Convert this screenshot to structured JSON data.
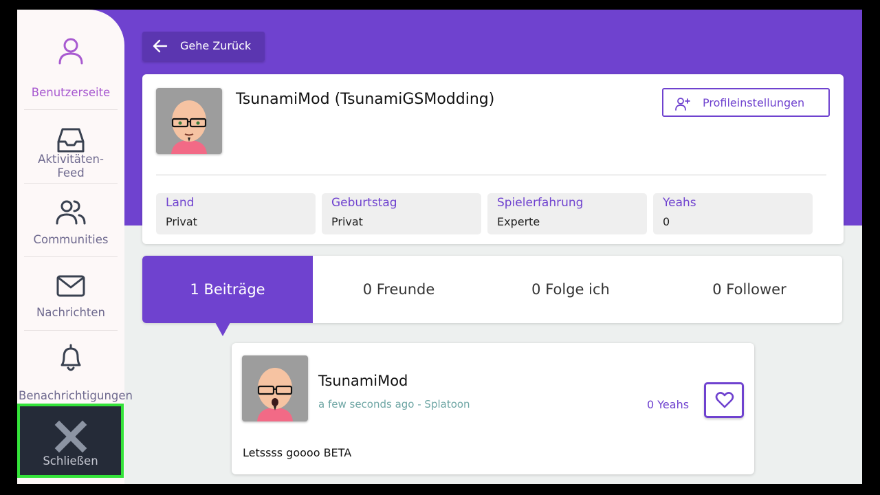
{
  "sidebar": {
    "items": [
      {
        "label": "Benutzerseite",
        "icon": "user-icon"
      },
      {
        "label": "Aktivitäten-",
        "label2": "Feed",
        "icon": "inbox-icon"
      },
      {
        "label": "Communities",
        "icon": "users-icon"
      },
      {
        "label": "Nachrichten",
        "icon": "mail-icon"
      },
      {
        "label": "Benachrichtigungen",
        "icon": "bell-icon"
      }
    ],
    "close_label": "Schließen"
  },
  "back_button": {
    "label": "Gehe Zurück",
    "icon": "arrow-left-icon"
  },
  "profile": {
    "name": "TsunamiMod (TsunamiGSModding)",
    "settings_label": "Profileinstellungen",
    "stats": [
      {
        "key": "Land",
        "value": "Privat"
      },
      {
        "key": "Geburtstag",
        "value": "Privat"
      },
      {
        "key": "Spielerfahrung",
        "value": "Experte"
      },
      {
        "key": "Yeahs",
        "value": "0"
      }
    ]
  },
  "tabs": [
    {
      "label": "1 Beiträge",
      "active": true
    },
    {
      "label": "0 Freunde"
    },
    {
      "label": "0 Folge ich"
    },
    {
      "label": "0 Follower"
    }
  ],
  "post": {
    "author": "TsunamiMod",
    "meta": "a few seconds ago - Splatoon",
    "yeahs": "0 Yeahs",
    "body": "Letssss goooo BETA"
  },
  "colors": {
    "accent": "#6f42cf",
    "sidebar_bg": "#fdf8f8",
    "focus": "#34e33a"
  }
}
